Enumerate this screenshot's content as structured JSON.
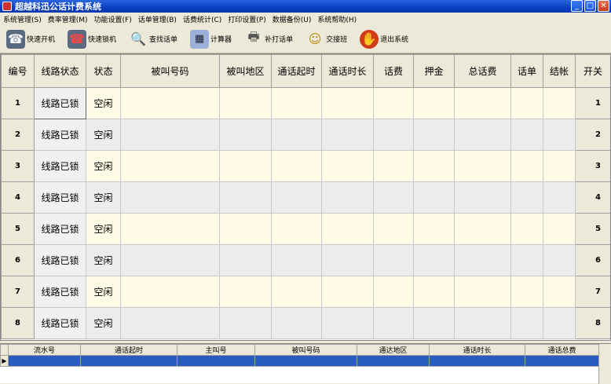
{
  "window": {
    "title": "超越科迅公话计费系统"
  },
  "menu": [
    "系统管理(S)",
    "费率管理(M)",
    "功能设置(F)",
    "话单管理(B)",
    "话费统计(C)",
    "打印设置(P)",
    "数据备份(U)",
    "系统帮助(H)"
  ],
  "toolbar": [
    {
      "label": "快速开机",
      "icon": "phone-unlock-icon"
    },
    {
      "label": "快速锁机",
      "icon": "phone-lock-icon"
    },
    {
      "label": "查找话单",
      "icon": "search-icon"
    },
    {
      "label": "计算器",
      "icon": "calculator-icon"
    },
    {
      "label": "补打话单",
      "icon": "printer-icon"
    },
    {
      "label": "交接班",
      "icon": "shift-change-icon"
    },
    {
      "label": "退出系统",
      "icon": "exit-icon"
    }
  ],
  "grid": {
    "headers": [
      "编号",
      "线路状态",
      "状态",
      "被叫号码",
      "被叫地区",
      "通话起时",
      "通话时长",
      "话费",
      "押金",
      "总话费",
      "话单",
      "结帐",
      "开关"
    ],
    "rows": [
      {
        "num": "1",
        "line": "线路已锁",
        "status": "空闲",
        "switch": "1"
      },
      {
        "num": "2",
        "line": "线路已锁",
        "status": "空闲",
        "switch": "2"
      },
      {
        "num": "3",
        "line": "线路已锁",
        "status": "空闲",
        "switch": "3"
      },
      {
        "num": "4",
        "line": "线路已锁",
        "status": "空闲",
        "switch": "4"
      },
      {
        "num": "5",
        "line": "线路已锁",
        "status": "空闲",
        "switch": "5"
      },
      {
        "num": "6",
        "line": "线路已锁",
        "status": "空闲",
        "switch": "6"
      },
      {
        "num": "7",
        "line": "线路已锁",
        "status": "空闲",
        "switch": "7"
      },
      {
        "num": "8",
        "line": "线路已锁",
        "status": "空闲",
        "switch": "8"
      }
    ]
  },
  "log": {
    "headers": [
      "流水号",
      "通话起时",
      "主叫号",
      "被叫号码",
      "通达地区",
      "通话时长",
      "通话总费"
    ],
    "pointer": "▶"
  }
}
